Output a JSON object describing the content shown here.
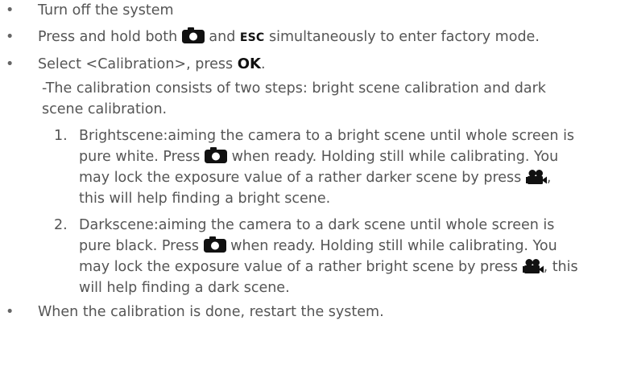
{
  "bullets": [
    "Turn off the system",
    {
      "a": "Press and hold both",
      "b": "and",
      "c": "ESC",
      "d": "simultaneously to enter factory mode."
    },
    {
      "a": "Select <Calibration>, press",
      "b": "OK",
      "c": "."
    },
    "When the calibration is done, restart the system."
  ],
  "note": [
    "-The calibration consists of two steps: bright scene calibration and dark",
    "scene calibration."
  ],
  "steps": [
    {
      "number": "1.",
      "line1": "Brightscene:aiming the camera to a bright scene until whole screen is",
      "line2a": "pure white.  Press",
      "line2b": "when ready. Holding still while calibrating. You",
      "line3a": "may lock the exposure value of a rather darker scene by press",
      "line3b": ",",
      "line4": "this will help finding a bright scene."
    },
    {
      "number": "2.",
      "line1": "Darkscene:aiming the camera to a dark scene until whole screen is",
      "line2a": "pure black. Press",
      "line2b": "when ready. Holding still while calibrating. You",
      "line3a": "may lock the exposure value of a rather bright scene by press",
      "line3b": ", this",
      "line4": "will help finding a dark scene."
    }
  ],
  "icons": {
    "camera": "camera-icon",
    "video": "video-camera-icon"
  }
}
